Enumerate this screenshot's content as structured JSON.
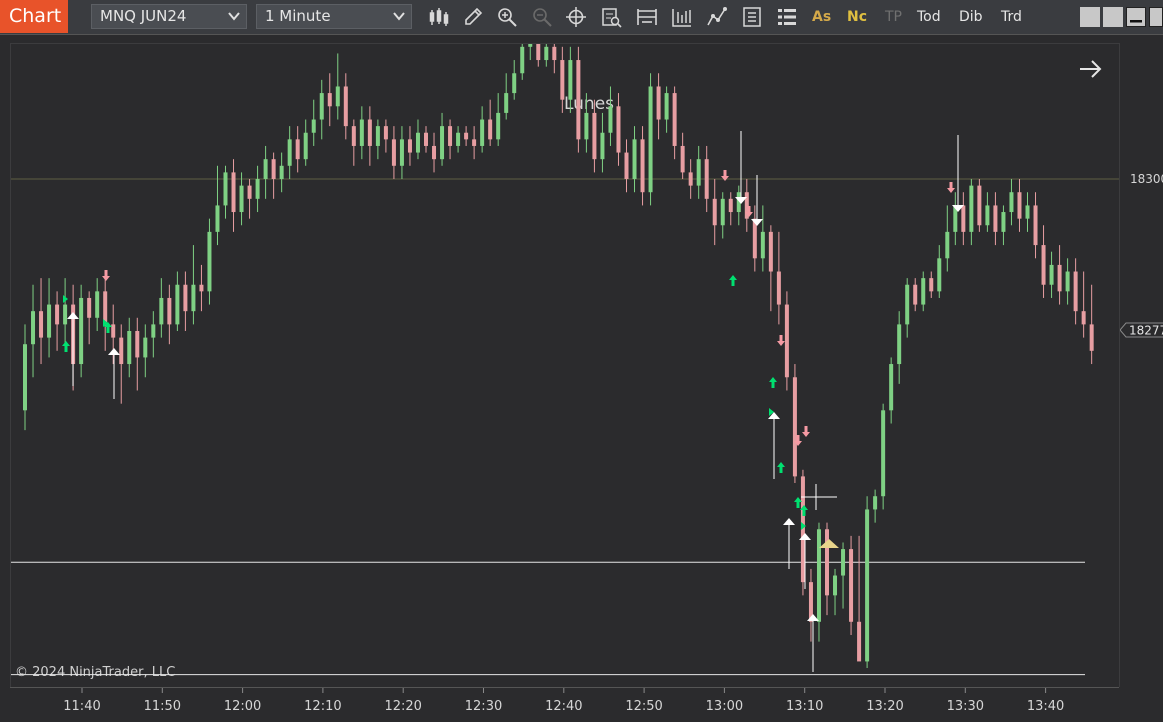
{
  "toolbar": {
    "chart_tab": "Chart",
    "instrument": "MNQ JUN24",
    "interval": "1 Minute",
    "tools": [
      {
        "label": "As",
        "color": "#d4a94a"
      },
      {
        "label": "Nc",
        "color": "#e0c040"
      },
      {
        "label": "TP",
        "color": "#707070"
      },
      {
        "label": "Tod",
        "color": "#e6e6e6"
      },
      {
        "label": "Dib",
        "color": "#e6e6e6"
      },
      {
        "label": "Trd",
        "color": "#e6e6e6"
      }
    ]
  },
  "chart": {
    "title": "Lunes",
    "copyright": "© 2024 NinjaTrader, LLC",
    "price_labels": [
      "18300",
      "18277"
    ],
    "time_labels": [
      "11:40",
      "11:50",
      "12:00",
      "12:10",
      "12:20",
      "12:30",
      "12:40",
      "12:50",
      "13:00",
      "13:10",
      "13:20",
      "13:30",
      "13:40"
    ],
    "colors": {
      "up": "#7fd184",
      "down": "#e79ea2",
      "signal_up": "#00e070",
      "signal_down": "#f59aa3",
      "marker": "#e8d48a",
      "background": "#2b2b2d"
    }
  },
  "chart_data": {
    "type": "candlestick",
    "title": "Lunes",
    "instrument": "MNQ JUN24",
    "interval": "1 Minute",
    "current_price": 18277,
    "reference_line": 18300,
    "candles": [
      [
        18265,
        18275,
        18262,
        18278
      ],
      [
        18275,
        18280,
        18270,
        18284
      ],
      [
        18280,
        18276,
        18272,
        18285
      ],
      [
        18276,
        18281,
        18273,
        18285
      ],
      [
        18281,
        18278,
        18274,
        18283
      ],
      [
        18278,
        18281,
        18275,
        18285
      ],
      [
        18281,
        18272,
        18268,
        18284
      ],
      [
        18272,
        18282,
        18270,
        18284
      ],
      [
        18282,
        18279,
        18275,
        18283
      ],
      [
        18279,
        18283,
        18277,
        18285
      ],
      [
        18283,
        18278,
        18274,
        18285
      ],
      [
        18278,
        18276,
        18272,
        18281
      ],
      [
        18276,
        18272,
        18266,
        18278
      ],
      [
        18272,
        18277,
        18270,
        18279
      ],
      [
        18277,
        18273,
        18268,
        18279
      ],
      [
        18273,
        18276,
        18270,
        18278
      ],
      [
        18276,
        18278,
        18273,
        18280
      ],
      [
        18278,
        18282,
        18276,
        18285
      ],
      [
        18282,
        18278,
        18275,
        18284
      ],
      [
        18278,
        18284,
        18277,
        18286
      ],
      [
        18284,
        18280,
        18277,
        18286
      ],
      [
        18280,
        18284,
        18278,
        18290
      ],
      [
        18284,
        18283,
        18280,
        18287
      ],
      [
        18283,
        18292,
        18281,
        18294
      ],
      [
        18292,
        18296,
        18290,
        18302
      ],
      [
        18296,
        18301,
        18294,
        18302
      ],
      [
        18301,
        18295,
        18292,
        18303
      ],
      [
        18295,
        18299,
        18293,
        18301
      ],
      [
        18299,
        18297,
        18294,
        18300
      ],
      [
        18297,
        18300,
        18295,
        18302
      ],
      [
        18300,
        18303,
        18297,
        18305
      ],
      [
        18303,
        18300,
        18297,
        18304
      ],
      [
        18300,
        18302,
        18298,
        18304
      ],
      [
        18302,
        18306,
        18300,
        18308
      ],
      [
        18306,
        18303,
        18301,
        18308
      ],
      [
        18303,
        18307,
        18302,
        18309
      ],
      [
        18307,
        18309,
        18305,
        18312
      ],
      [
        18309,
        18313,
        18306,
        18315
      ],
      [
        18313,
        18311,
        18308,
        18316
      ],
      [
        18311,
        18314,
        18309,
        18319
      ],
      [
        18314,
        18308,
        18306,
        18316
      ],
      [
        18308,
        18305,
        18302,
        18309
      ],
      [
        18305,
        18309,
        18303,
        18311
      ],
      [
        18309,
        18305,
        18302,
        18311
      ],
      [
        18305,
        18308,
        18303,
        18309
      ],
      [
        18308,
        18306,
        18304,
        18309
      ],
      [
        18306,
        18302,
        18300,
        18308
      ],
      [
        18302,
        18306,
        18300,
        18308
      ],
      [
        18306,
        18304,
        18302,
        18308
      ],
      [
        18304,
        18307,
        18303,
        18309
      ],
      [
        18307,
        18305,
        18304,
        18308
      ],
      [
        18305,
        18303,
        18301,
        18307
      ],
      [
        18303,
        18308,
        18302,
        18310
      ],
      [
        18308,
        18305,
        18303,
        18309
      ],
      [
        18305,
        18307,
        18304,
        18308
      ],
      [
        18307,
        18306,
        18305,
        18308
      ],
      [
        18306,
        18305,
        18303,
        18308
      ],
      [
        18305,
        18309,
        18304,
        18311
      ],
      [
        18309,
        18306,
        18305,
        18312
      ],
      [
        18306,
        18310,
        18305,
        18313
      ],
      [
        18310,
        18313,
        18309,
        18316
      ],
      [
        18313,
        18316,
        18312,
        18318
      ],
      [
        18316,
        18320,
        18315,
        18322
      ],
      [
        18320,
        18322,
        18318,
        18323
      ],
      [
        18322,
        18318,
        18317,
        18323
      ],
      [
        18318,
        18320,
        18317,
        18321
      ],
      [
        18320,
        18318,
        18316,
        18321
      ],
      [
        18318,
        18312,
        18310,
        18320
      ],
      [
        18312,
        18318,
        18310,
        18320
      ],
      [
        18318,
        18306,
        18304,
        18320
      ],
      [
        18306,
        18310,
        18304,
        18313
      ],
      [
        18310,
        18303,
        18301,
        18312
      ],
      [
        18303,
        18307,
        18301,
        18310
      ],
      [
        18307,
        18311,
        18305,
        18314
      ],
      [
        18311,
        18304,
        18302,
        18313
      ],
      [
        18304,
        18300,
        18298,
        18306
      ],
      [
        18300,
        18306,
        18298,
        18308
      ],
      [
        18306,
        18298,
        18296,
        18308
      ],
      [
        18298,
        18314,
        18296,
        18316
      ],
      [
        18314,
        18309,
        18306,
        18316
      ],
      [
        18309,
        18313,
        18307,
        18314
      ],
      [
        18313,
        18305,
        18303,
        18314
      ],
      [
        18305,
        18301,
        18300,
        18307
      ],
      [
        18301,
        18299,
        18297,
        18303
      ],
      [
        18299,
        18303,
        18297,
        18305
      ],
      [
        18303,
        18297,
        18295,
        18305
      ],
      [
        18297,
        18293,
        18290,
        18300
      ],
      [
        18293,
        18297,
        18291,
        18298
      ],
      [
        18297,
        18295,
        18293,
        18298
      ],
      [
        18295,
        18298,
        18293,
        18299
      ],
      [
        18298,
        18294,
        18292,
        18300
      ],
      [
        18294,
        18288,
        18286,
        18296
      ],
      [
        18288,
        18292,
        18286,
        18296
      ],
      [
        18292,
        18286,
        18280,
        18293
      ],
      [
        18286,
        18281,
        18278,
        18292
      ],
      [
        18281,
        18270,
        18268,
        18283
      ],
      [
        18270,
        18255,
        18254,
        18272
      ],
      [
        18255,
        18239,
        18237,
        18256
      ],
      [
        18239,
        18233,
        18230,
        18241
      ],
      [
        18233,
        18247,
        18230,
        18248
      ],
      [
        18247,
        18237,
        18234,
        18248
      ],
      [
        18237,
        18240,
        18234,
        18241
      ],
      [
        18240,
        18244,
        18235,
        18245
      ],
      [
        18244,
        18233,
        18231,
        18246
      ],
      [
        18233,
        18227,
        18228,
        18246
      ],
      [
        18227,
        18250,
        18226,
        18252
      ],
      [
        18250,
        18252,
        18248,
        18253
      ],
      [
        18252,
        18265,
        18250,
        18266
      ],
      [
        18265,
        18272,
        18263,
        18273
      ],
      [
        18272,
        18278,
        18269,
        18280
      ],
      [
        18278,
        18284,
        18276,
        18285
      ],
      [
        18284,
        18281,
        18280,
        18285
      ],
      [
        18281,
        18285,
        18280,
        18286
      ],
      [
        18285,
        18283,
        18282,
        18286
      ],
      [
        18283,
        18288,
        18282,
        18290
      ],
      [
        18288,
        18292,
        18286,
        18296
      ],
      [
        18292,
        18296,
        18290,
        18298
      ],
      [
        18296,
        18292,
        18290,
        18298
      ],
      [
        18292,
        18299,
        18290,
        18300
      ],
      [
        18299,
        18293,
        18292,
        18300
      ],
      [
        18293,
        18296,
        18292,
        18298
      ],
      [
        18296,
        18292,
        18290,
        18298
      ],
      [
        18292,
        18295,
        18290,
        18296
      ],
      [
        18295,
        18298,
        18293,
        18300
      ],
      [
        18298,
        18294,
        18292,
        18300
      ],
      [
        18294,
        18296,
        18292,
        18298
      ],
      [
        18296,
        18290,
        18288,
        18298
      ],
      [
        18290,
        18284,
        18282,
        18293
      ],
      [
        18284,
        18287,
        18282,
        18289
      ],
      [
        18287,
        18283,
        18281,
        18290
      ],
      [
        18283,
        18286,
        18281,
        18288
      ],
      [
        18286,
        18280,
        18278,
        18288
      ],
      [
        18280,
        18278,
        18276,
        18286
      ],
      [
        18278,
        18274,
        18272,
        18284
      ]
    ],
    "candle_format": [
      "open",
      "close",
      "low",
      "high"
    ],
    "support_lines": [
      18242,
      18225
    ],
    "x_tick_labels": [
      "11:40",
      "11:50",
      "12:00",
      "12:10",
      "12:20",
      "12:30",
      "12:40",
      "12:50",
      "13:00",
      "13:10",
      "13:20",
      "13:30",
      "13:40"
    ],
    "y_tick_labels": [
      "18300",
      "18277"
    ]
  }
}
